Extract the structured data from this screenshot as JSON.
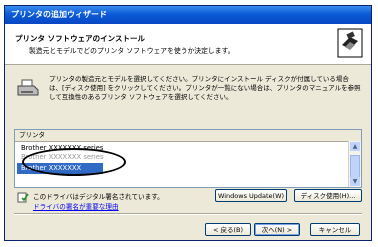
{
  "window": {
    "title": "プリンタの追加ウィザード"
  },
  "header": {
    "title": "プリンタ ソフトウェアのインストール",
    "subtitle": "製造元とモデルでどのプリンタ ソフトウェアを使うか決定します。"
  },
  "description": "プリンタの製造元とモデルを選択してください。プリンタにインストール ディスクが付属している場合は、[ディスク使用] をクリックしてください。プリンタが一覧にない場合は、プリンタのマニュアルを参照して互換性のあるプリンタ ソフトウェアを選択してください。",
  "printer_list": {
    "header": "プリンタ",
    "items": [
      "Brother XXXXXXX series",
      "Brother XXXXXXX series",
      "Brother XXXXXXX series"
    ],
    "selected_index": 2
  },
  "signature": {
    "text": "このドライバはデジタル署名されています。",
    "link": "ドライバの署名が重要な理由"
  },
  "buttons": {
    "windows_update": "Windows Update(W)",
    "have_disk": "ディスク使用(H)...",
    "back": "< 戻る(B)",
    "next": "次へ(N) >",
    "cancel": "キャンセル"
  },
  "colors": {
    "selection": "#316ac5",
    "titlebar": "#0a5bd6",
    "link": "#0000ee"
  }
}
